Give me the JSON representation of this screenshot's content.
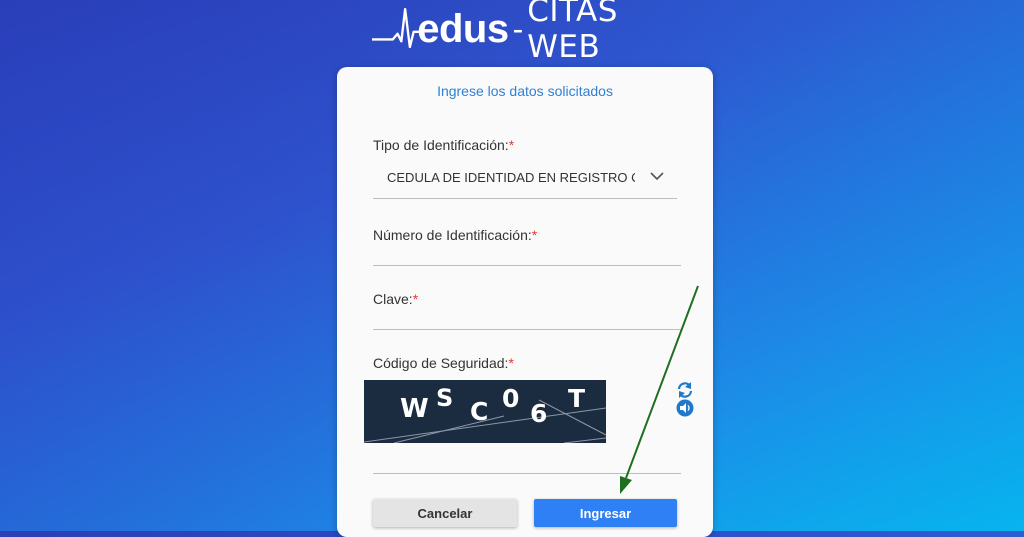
{
  "header": {
    "brand": "edus",
    "separator": "-",
    "subtitle": "CITAS WEB"
  },
  "form": {
    "title": "Ingrese los datos solicitados",
    "id_type": {
      "label": "Tipo de Identificación:",
      "required_mark": "*",
      "selected_value": "CEDULA DE IDENTIDAD EN REGISTRO CIVIL"
    },
    "id_number": {
      "label": "Número de Identificación:",
      "required_mark": "*",
      "value": ""
    },
    "password": {
      "label": "Clave:",
      "required_mark": "*",
      "value": ""
    },
    "security_code": {
      "label": "Código de Seguridad:",
      "required_mark": "*",
      "captcha_chars": [
        "W",
        "S",
        "C",
        "0",
        "6",
        "T"
      ],
      "value": "",
      "refresh_icon": "refresh-icon",
      "audio_icon": "speaker-icon"
    },
    "buttons": {
      "cancel": "Cancelar",
      "submit": "Ingresar"
    }
  },
  "annotation": {
    "arrow_color": "#1f6e1f"
  },
  "colors": {
    "accent": "#2f7fd6",
    "primary_button": "#2f7ff5",
    "required": "#e53935"
  }
}
